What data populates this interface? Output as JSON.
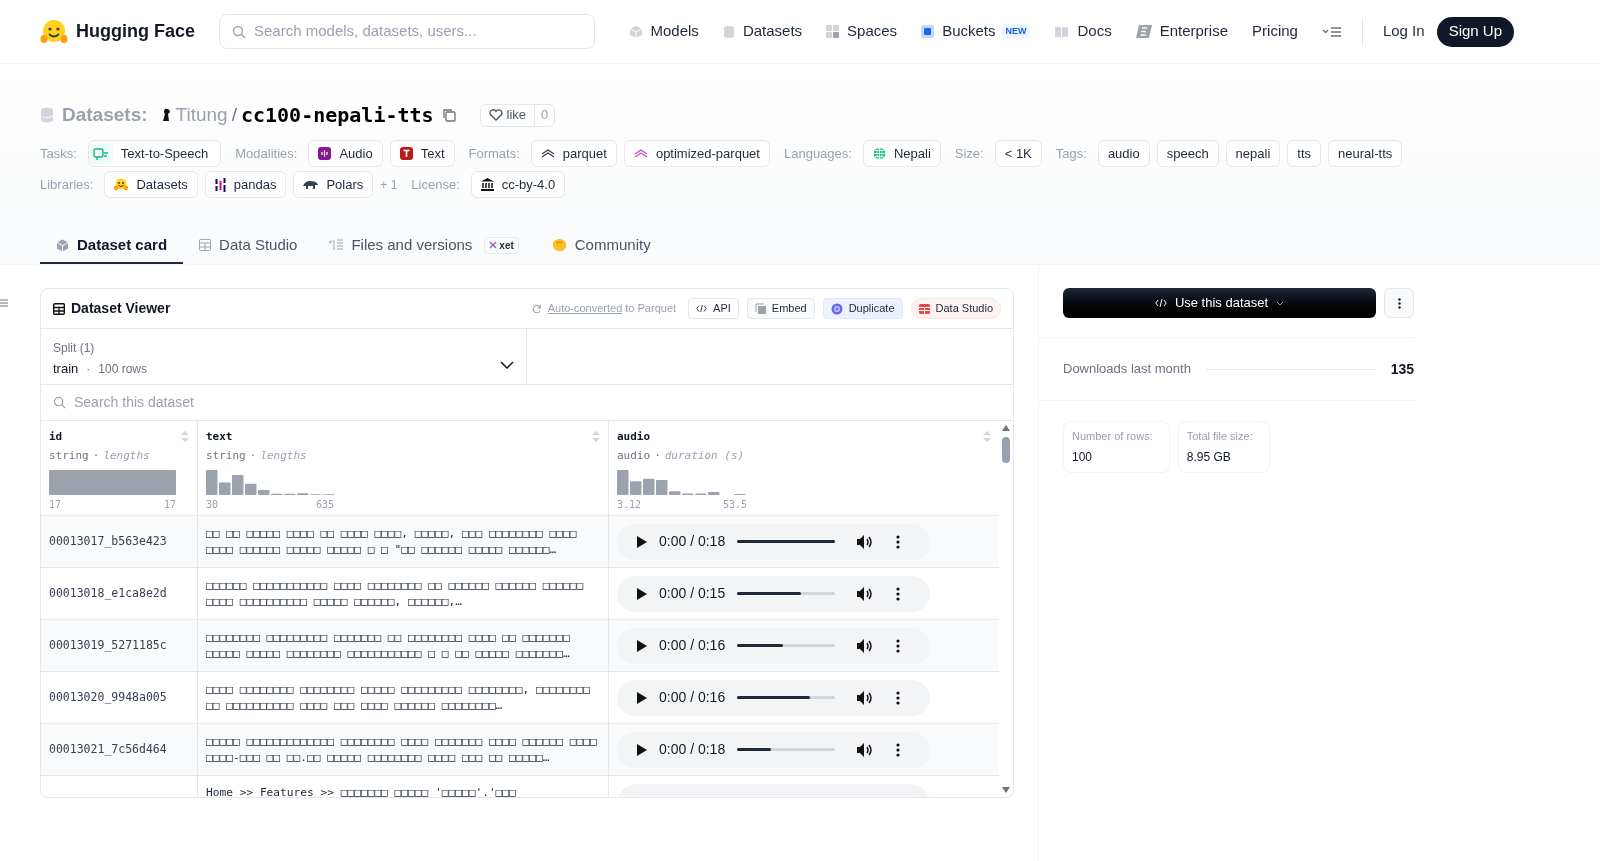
{
  "nav": {
    "logo": "Hugging Face",
    "search_placeholder": "Search models, datasets, users...",
    "items": [
      {
        "label": "Models",
        "kind": "cube"
      },
      {
        "label": "Datasets",
        "kind": "db"
      },
      {
        "label": "Spaces",
        "kind": "grid"
      },
      {
        "label": "Buckets",
        "kind": "bucket",
        "badge": "NEW"
      },
      {
        "label": "Docs",
        "kind": "book"
      },
      {
        "label": "Enterprise",
        "kind": "enterprise"
      },
      {
        "label": "Pricing",
        "kind": "none"
      }
    ],
    "login": "Log In",
    "signup": "Sign Up"
  },
  "repo": {
    "prefix": "Datasets:",
    "owner": "Titung",
    "separator": "/",
    "name": "cc100-nepali-tts",
    "like": "like",
    "likes": "0"
  },
  "meta_rows": [
    [
      {
        "label": "Tasks:",
        "chips": [
          {
            "text": "Text-to-Speech",
            "kind": "tts"
          }
        ]
      },
      {
        "label": "Modalities:",
        "chips": [
          {
            "text": "Audio",
            "kind": "audio"
          },
          {
            "text": "Text",
            "kind": "text"
          }
        ]
      },
      {
        "label": "Formats:",
        "chips": [
          {
            "text": "parquet",
            "kind": "parquet"
          },
          {
            "text": "optimized-parquet",
            "kind": "optparquet"
          }
        ]
      },
      {
        "label": "Languages:",
        "chips": [
          {
            "text": "Nepali",
            "kind": "globe"
          }
        ]
      },
      {
        "label": "Size:",
        "chips": [
          {
            "text": "< 1K",
            "kind": "plain"
          }
        ]
      },
      {
        "label": "Tags:",
        "chips": [
          {
            "text": "audio",
            "kind": "plain"
          },
          {
            "text": "speech",
            "kind": "plain"
          },
          {
            "text": "nepali",
            "kind": "plain"
          },
          {
            "text": "tts",
            "kind": "plain"
          },
          {
            "text": "neural-tts",
            "kind": "plain"
          }
        ]
      }
    ],
    [
      {
        "label": "Libraries:",
        "chips": [
          {
            "text": "Datasets",
            "kind": "hf"
          },
          {
            "text": "pandas",
            "kind": "pandas"
          },
          {
            "text": "Polars",
            "kind": "polars"
          },
          {
            "text": "+ 1",
            "kind": "more"
          }
        ]
      },
      {
        "label": "License:",
        "chips": [
          {
            "text": "cc-by-4.0",
            "kind": "license"
          }
        ]
      }
    ]
  ],
  "tabs": [
    {
      "label": "Dataset card",
      "kind": "card",
      "selected": true
    },
    {
      "label": "Data Studio",
      "kind": "table",
      "selected": false
    },
    {
      "label": "Files and versions",
      "kind": "files",
      "selected": false,
      "badge": "xet"
    },
    {
      "label": "Community",
      "kind": "community",
      "selected": false
    }
  ],
  "viewer": {
    "title": "Dataset Viewer",
    "converted_link": "Auto-converted",
    "converted_suffix": "to Parquet",
    "buttons": [
      {
        "label": "API",
        "kind": "api"
      },
      {
        "label": "Embed",
        "kind": "embed"
      },
      {
        "label": "Duplicate",
        "kind": "duplicate"
      },
      {
        "label": "Data Studio",
        "kind": "studio"
      }
    ],
    "split_label": "Split (1)",
    "split_name": "train",
    "split_dot": "·",
    "split_rows": "100 rows",
    "search_placeholder": "Search this dataset",
    "columns": [
      {
        "name": "id",
        "type": "string",
        "dot": "·",
        "stat": "lengths",
        "min": "17",
        "max": "17",
        "kind": "id"
      },
      {
        "name": "text",
        "type": "string",
        "dot": "·",
        "stat": "lengths",
        "min": "30",
        "max": "635",
        "kind": "text"
      },
      {
        "name": "audio",
        "type": "audio",
        "dot": "·",
        "stat": "duration (s)",
        "min": "3.12",
        "max": "53.5",
        "kind": "audio"
      }
    ],
    "rows": [
      {
        "id": "00013017_b563e423",
        "text": "□□ □□ □□□□□ □□□□ □□ □□□□ □□□□, □□□□□, □□□ □□□□□□□□ □□□□ □□□□ □□□□□□ □□□□□ □□□□□ □ □ \"□□ □□□□□□ □□□□□ □□□□□□…",
        "time": "0:00 / 0:18",
        "level": 1.0
      },
      {
        "id": "00013018_e1ca8e2d",
        "text": "□□□□□□ □□□□□□□□□□□ □□□□ □□□□□□□□ □□ □□□□□□ □□□□□□ □□□□□□ □□□□ □□□□□□□□□□ □□□□□ □□□□□□, □□□□□□,…",
        "time": "0:00 / 0:15",
        "level": 0.65
      },
      {
        "id": "00013019_5271185c",
        "text": "□□□□□□□□ □□□□□□□□□ □□□□□□□ □□ □□□□□□□□ □□□□ □□ □□□□□□□ □□□□□ □□□□□ □□□□□□□□ □□□□□□□□□□□ □ □ □□ □□□□□ □□□□□□□…",
        "time": "0:00 / 0:16",
        "level": 0.47
      },
      {
        "id": "00013020_9948a005",
        "text": "□□□□ □□□□□□□□ □□□□□□□□ □□□□□ □□□□□□□□□ □□□□□□□□, □□□□□□□□ □□ □□□□□□□□□□ □□□□ □□□ □□□□ □□□□□□ □□□□□□□□…",
        "time": "0:00 / 0:16",
        "level": 0.74
      },
      {
        "id": "00013021_7c56d464",
        "text": "□□□□□ □□□□□□□□□□□□□ □□□□□□□□ □□□□ □□□□□□□ □□□□ □□□□□□ □□□□ □□□□-□□□ □□ □□.□□ □□□□□ □□□□□□□□ □□□□ □□□ □□ □□□□□…",
        "time": "0:00 / 0:18",
        "level": 0.35
      },
      {
        "text": "Home >> Features >> □□□□□□□ □□□□□ '□□□□□'.'□□□"
      }
    ]
  },
  "sidebar": {
    "use_button": "Use this dataset",
    "downloads_label": "Downloads last month",
    "downloads": "135",
    "stats": [
      {
        "label": "Number of rows:",
        "value": "100"
      },
      {
        "label": "Total file size:",
        "value": "8.95 GB"
      }
    ]
  }
}
